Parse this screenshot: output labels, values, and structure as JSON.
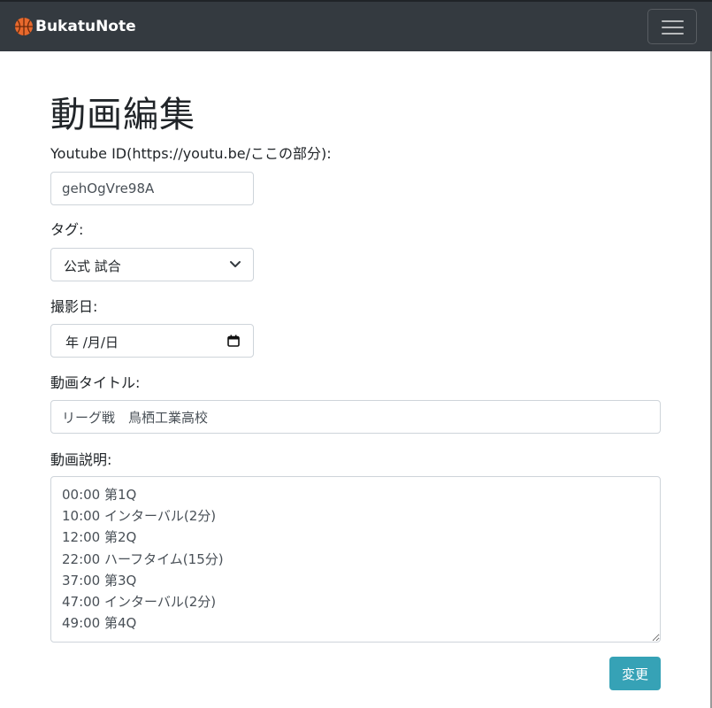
{
  "navbar": {
    "brand": "BukatuNote",
    "brand_icon": "basketball-icon",
    "toggler_icon": "hamburger-menu-icon"
  },
  "page": {
    "title": "動画編集"
  },
  "form": {
    "youtube_label": "Youtube ID(https://youtu.be/ここの部分):",
    "youtube_value": "gehOgVre98A",
    "tag_label": "タグ:",
    "tag_value": "公式 試合",
    "date_label": "撮影日:",
    "date_value": "年 /月/日",
    "title_label": "動画タイトル:",
    "title_value": "リーグ戦　鳥栖工業高校",
    "desc_label": "動画説明:",
    "desc_value": "00:00 第1Q\n10:00 インターバル(2分)\n12:00 第2Q\n22:00 ハーフタイム(15分)\n37:00 第3Q\n47:00 インターバル(2分)\n49:00 第4Q",
    "submit_label": "変更"
  },
  "colors": {
    "navbar_bg": "#343a40",
    "submit_bg": "#36a2b6"
  }
}
